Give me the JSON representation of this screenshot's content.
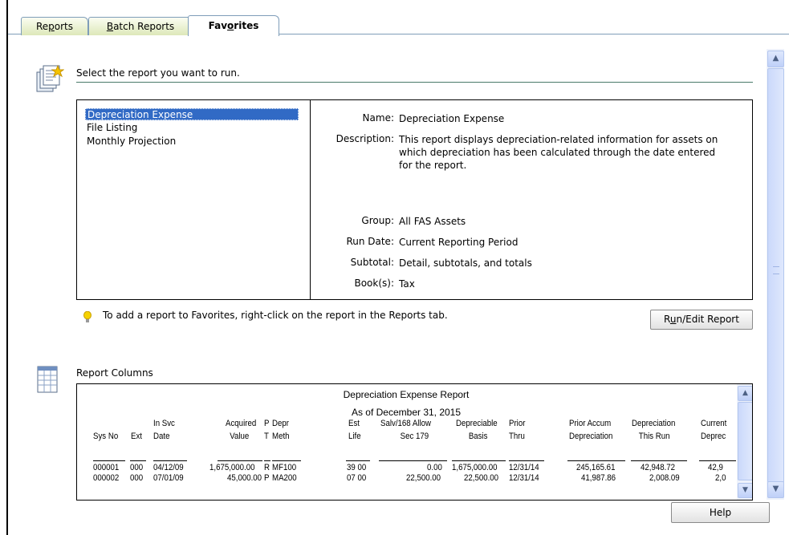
{
  "tabs": [
    {
      "label_pre": "Re",
      "label_u": "p",
      "label_post": "orts"
    },
    {
      "label_pre": "",
      "label_u": "B",
      "label_post": "atch Reports"
    },
    {
      "label_pre": "Fav",
      "label_u": "o",
      "label_post": "rites"
    }
  ],
  "header": {
    "title": "Select the report you want to run."
  },
  "reports": [
    {
      "label": "Depreciation Expense",
      "selected": true
    },
    {
      "label": "File Listing",
      "selected": false
    },
    {
      "label": "Monthly Projection",
      "selected": false
    }
  ],
  "details": {
    "name_label": "Name:",
    "name": "Depreciation Expense",
    "description_label": "Description:",
    "description": "This report displays depreciation-related information for assets on which depreciation has been calculated through the date entered for the report.",
    "group_label": "Group:",
    "group": "All FAS Assets",
    "run_date_label": "Run Date:",
    "run_date": "Current Reporting Period",
    "subtotal_label": "Subtotal:",
    "subtotal": "Detail, subtotals, and totals",
    "books_label": "Book(s):",
    "books": "Tax"
  },
  "tip": {
    "text": "To add a report to Favorites, right-click on the report in the Reports tab."
  },
  "run_button": {
    "pre": "R",
    "u": "u",
    "post": "n/Edit Report"
  },
  "columns_section": {
    "title": "Report Columns"
  },
  "preview": {
    "title": "Depreciation Expense Report",
    "subtitle": "As of December 31, 2015",
    "headers": [
      [
        "",
        "Sys No"
      ],
      [
        "",
        "Ext"
      ],
      [
        "In Svc",
        "Date"
      ],
      [
        "Acquired",
        "Value"
      ],
      [
        "P",
        "T"
      ],
      [
        "Depr",
        "Meth"
      ],
      [
        "Est",
        "Life"
      ],
      [
        "Salv/168 Allow",
        "Sec 179"
      ],
      [
        "Depreciable",
        "Basis"
      ],
      [
        "Prior",
        "Thru"
      ],
      [
        "Prior Accum",
        "Depreciation"
      ],
      [
        "Depreciation",
        "This Run"
      ],
      [
        "Current",
        "Deprec"
      ]
    ],
    "rows": [
      [
        "000001",
        "000",
        "04/12/09",
        "1,675,000.00",
        "R",
        "MF100",
        "39  00",
        "0.00",
        "1,675,000.00",
        "12/31/14",
        "245,165.61",
        "42,948.72",
        "42,9"
      ],
      [
        "000002",
        "000",
        "07/01/09",
        "45,000.00",
        "P",
        "MA200",
        "07  00",
        "22,500.00",
        "22,500.00",
        "12/31/14",
        "41,987.86",
        "2,008.09",
        "2,0"
      ]
    ]
  },
  "help_button": {
    "label": "Help"
  },
  "colors": {
    "selection": "#316ac5",
    "tab_gradient_end": "#dde8b9",
    "scrollbar": "#bfd0f8"
  }
}
